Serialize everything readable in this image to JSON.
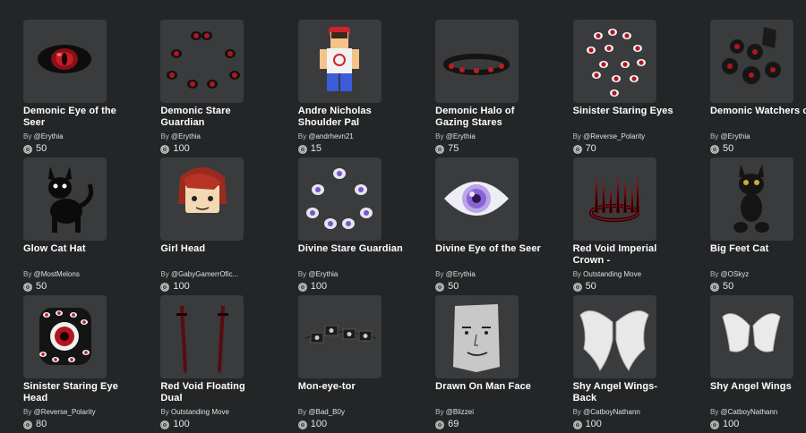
{
  "items": [
    {
      "name": "Demonic Eye of the Seer",
      "by": "By",
      "creator": "@Erythia",
      "price": "50",
      "thumb_icon": "red-eye"
    },
    {
      "name": "Demonic Stare Guardian",
      "by": "By",
      "creator": "@Erythia",
      "price": "100",
      "thumb_icon": "red-eyes-ring"
    },
    {
      "name": "Andre Nicholas Shoulder Pal",
      "by": "By",
      "creator": "@andrhevn21",
      "price": "15",
      "thumb_icon": "avatar-figure"
    },
    {
      "name": "Demonic Halo of Gazing Stares",
      "by": "By",
      "creator": "@Erythia",
      "price": "75",
      "thumb_icon": "eye-halo"
    },
    {
      "name": "Sinister Staring Eyes",
      "by": "By",
      "creator": "@Reverse_Polarity",
      "price": "70",
      "thumb_icon": "many-red-eyes"
    },
    {
      "name": "Demonic Watchers of",
      "by": "By",
      "creator": "@Erythia",
      "price": "50",
      "thumb_icon": "dark-eye-orbs"
    },
    {
      "name": "Glow Cat Hat",
      "by": "By",
      "creator": "@MostMelons",
      "price": "50",
      "thumb_icon": "black-cat"
    },
    {
      "name": "Girl Head",
      "by": "By",
      "creator": "@GabyGamerrOfic...",
      "price": "100",
      "thumb_icon": "girl-head"
    },
    {
      "name": "Divine Stare Guardian",
      "by": "By",
      "creator": "@Erythia",
      "price": "100",
      "thumb_icon": "white-eyes-ring"
    },
    {
      "name": "Divine Eye of the Seer",
      "by": "By",
      "creator": "@Erythia",
      "price": "50",
      "thumb_icon": "white-eye"
    },
    {
      "name": "Red Void Imperial Crown -",
      "by": "By",
      "creator": "Outstanding Move",
      "price": "50",
      "thumb_icon": "spike-crown"
    },
    {
      "name": "Big Feet Cat",
      "by": "By",
      "creator": "@OSkyz",
      "price": "50",
      "thumb_icon": "big-feet-cat"
    },
    {
      "name": "Sinister Staring Eye Head",
      "by": "By",
      "creator": "@Reverse_Polarity",
      "price": "80",
      "thumb_icon": "eye-head"
    },
    {
      "name": "Red Void Floating Dual",
      "by": "By",
      "creator": "Outstanding Move",
      "price": "100",
      "thumb_icon": "dual-swords"
    },
    {
      "name": "Mon-eye-tor",
      "by": "By",
      "creator": "@Bad_B0y",
      "price": "100",
      "thumb_icon": "monitors"
    },
    {
      "name": "Drawn On Man Face",
      "by": "By",
      "creator": "@Blizzei",
      "price": "69",
      "thumb_icon": "paper-face"
    },
    {
      "name": "Shy Angel Wings-Back",
      "by": "By",
      "creator": "@CatboyNathann",
      "price": "100",
      "thumb_icon": "angel-wings"
    },
    {
      "name": "Shy Angel Wings",
      "by": "By",
      "creator": "@CatboyNathann",
      "price": "100",
      "thumb_icon": "angel-wings-small"
    }
  ],
  "colors": {
    "background": "#232527",
    "thumb_bg": "#393b3d",
    "text": "#ffffff",
    "muted": "#bdbebe"
  }
}
